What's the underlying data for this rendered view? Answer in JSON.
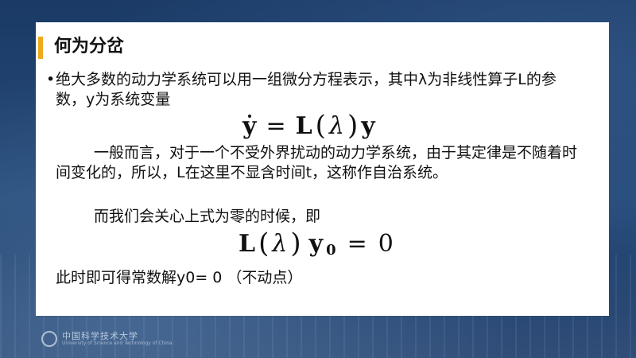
{
  "slide": {
    "title": "何为分岔",
    "bullet": "•",
    "p1": "绝大多数的动力学系统可以用一组微分方程表示，其中λ为非线性算子L的参数，y为系统变量",
    "eq1": {
      "lhs": "y",
      "eq": "=",
      "op": "L",
      "lparen": "(",
      "lambda": "λ",
      "rparen": ")",
      "rhs": "y"
    },
    "p2": "一般而言，对于一个不受外界扰动的动力学系统，由于其定律是不随着时间变化的，所以，L在这里不显含时间t，这称作自治系统。",
    "p3": "而我们会关心上式为零的时候，即",
    "eq2": {
      "op": "L",
      "lparen": "(",
      "lambda": "λ",
      "rparen": ")",
      "y": "y",
      "sub": "0",
      "eq": "=",
      "zero": "0"
    },
    "p4": "此时即可得常数解y0= 0 （不动点）"
  },
  "footer": {
    "logo_text": "中国科学技术大学",
    "logo_sub": "University of Science and Technology of China"
  }
}
